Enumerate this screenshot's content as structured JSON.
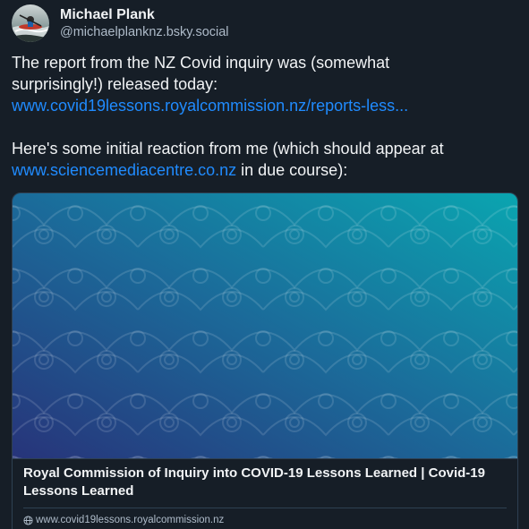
{
  "author": {
    "display_name": "Michael Plank",
    "handle": "@michaelplanknz.bsky.social",
    "avatar": "kayak-avatar"
  },
  "post": {
    "line1": "The report from the NZ Covid inquiry was (somewhat",
    "line2": "surprisingly!) released today:",
    "link1": "www.covid19lessons.royalcommission.nz/reports-less...",
    "line4": "Here's some initial reaction from me (which should appear at",
    "link2": "www.sciencemediacentre.co.nz",
    "line5_suffix": " in due course):"
  },
  "link_card": {
    "title": "Royal Commission of Inquiry into COVID-19 Lessons Learned | Covid-19 Lessons Learned",
    "domain": "www.covid19lessons.royalcommission.nz",
    "domain_icon": "globe-icon",
    "image": "koru-pattern-gradient"
  },
  "colors": {
    "background": "#161e27",
    "text": "#f1f3f5",
    "secondary_text": "#aebbc9",
    "link": "#208bfe",
    "border": "#2e4052",
    "card_gradient_start": "#27347a",
    "card_gradient_end": "#0aa5b0"
  }
}
